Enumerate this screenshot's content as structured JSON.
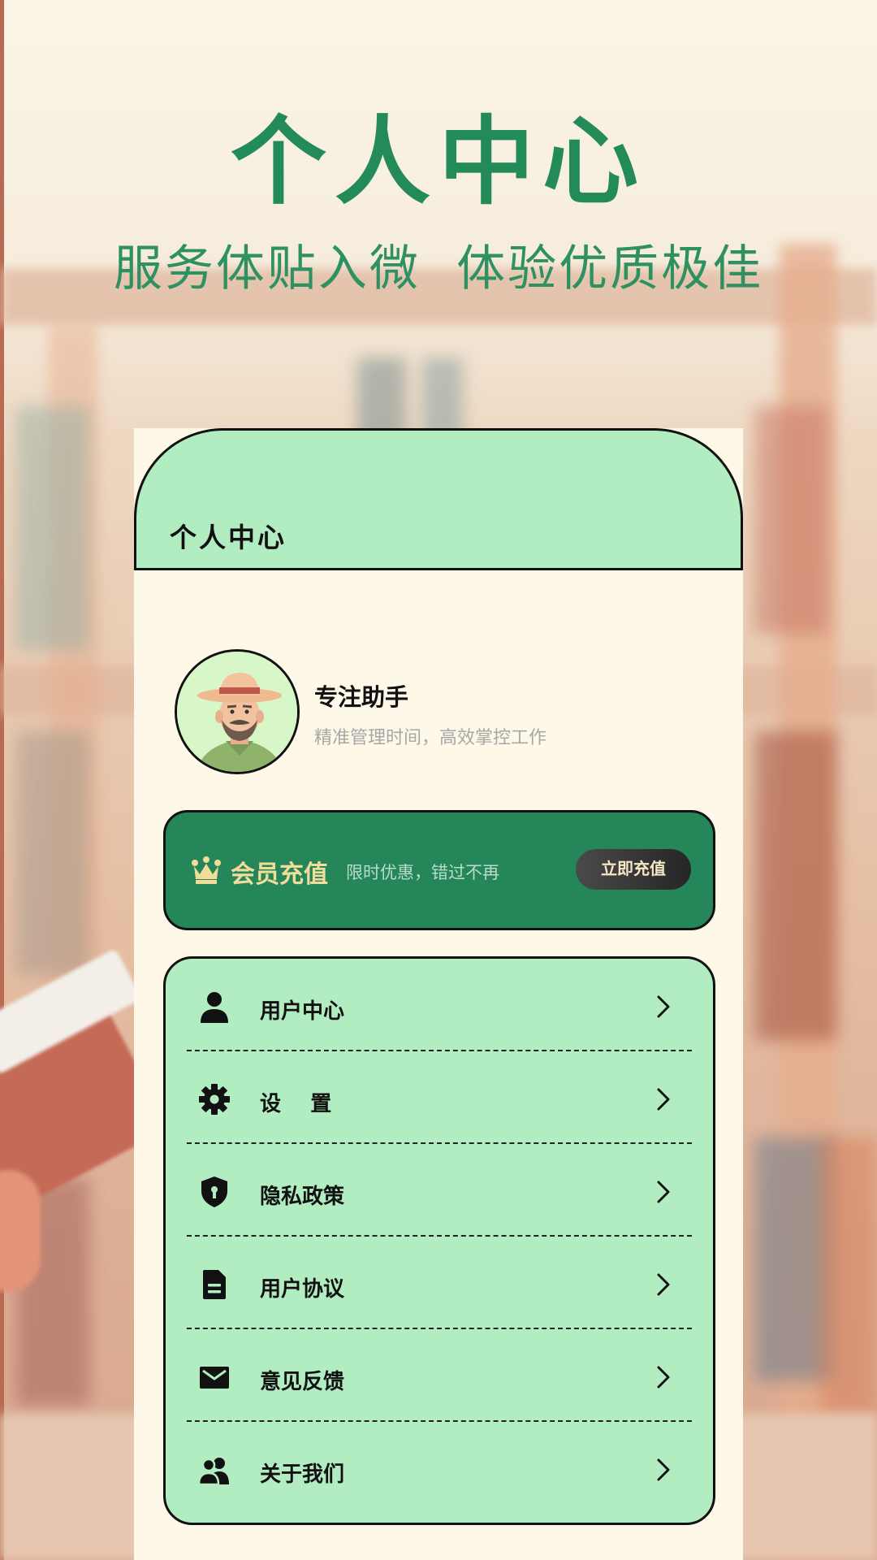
{
  "hero": {
    "title": "个人中心",
    "subtitle": "服务体贴入微  体验优质极佳"
  },
  "header": {
    "title": "个人中心"
  },
  "profile": {
    "name": "专注助手",
    "description": "精准管理时间，高效掌控工作",
    "avatar_icon": "farmer-avatar"
  },
  "vip": {
    "icon": "crown-icon",
    "title": "会员充值",
    "description": "限时优惠，错过不再",
    "button_label": "立即充值"
  },
  "menu": {
    "items": [
      {
        "label": "用户中心",
        "icon": "user-icon"
      },
      {
        "label": "设    置",
        "icon": "gear-icon"
      },
      {
        "label": "隐私政策",
        "icon": "shield-icon"
      },
      {
        "label": "用户协议",
        "icon": "document-icon"
      },
      {
        "label": "意见反馈",
        "icon": "mail-icon"
      },
      {
        "label": "关于我们",
        "icon": "users-icon"
      }
    ]
  },
  "colors": {
    "brand_green": "#238a5a",
    "header_mint": "#b2edc2",
    "card_cream": "#fdf8e8",
    "vip_gold": "#f2dc9a"
  }
}
